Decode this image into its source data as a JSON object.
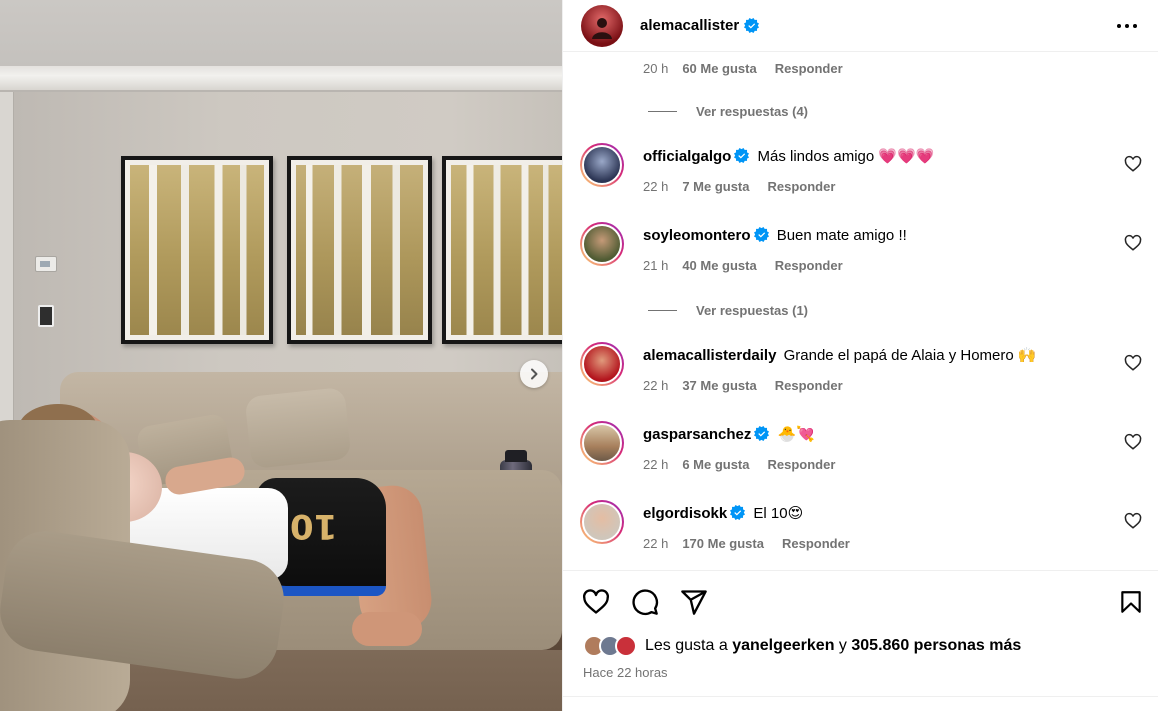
{
  "post": {
    "author": "alemacallister",
    "carousel_next_label": "›"
  },
  "comments_partial": {
    "time": "20 h",
    "likes": "60 Me gusta",
    "reply": "Responder",
    "view_replies": "Ver respuestas (4)"
  },
  "comments": [
    {
      "username": "officialgalgo",
      "verified": true,
      "text": "Más lindos amigo 💗💗💗",
      "time": "22 h",
      "likes": "7 Me gusta",
      "reply": "Responder",
      "avatar_color": "#4b5c8a",
      "ring": "story"
    },
    {
      "username": "soyleomontero",
      "verified": true,
      "text": "Buen mate amigo !!",
      "time": "21 h",
      "likes": "40 Me gusta",
      "reply": "Responder",
      "avatar_color": "#5a6b3c",
      "ring": "story"
    },
    {
      "username": "alemacallisterdaily",
      "verified": false,
      "text": "Grande el papá de Alaia y Homero 🙌",
      "time": "22 h",
      "likes": "37 Me gusta",
      "reply": "Responder",
      "avatar_color": "#c7202a",
      "ring": "story"
    },
    {
      "username": "gasparsanchez",
      "verified": true,
      "text": "🐣💘",
      "time": "22 h",
      "likes": "6 Me gusta",
      "reply": "Responder",
      "avatar_color": "#b8906a",
      "ring": "story"
    },
    {
      "username": "elgordisokk",
      "verified": true,
      "text": "El 10😍",
      "time": "22 h",
      "likes": "170 Me gusta",
      "reply": "Responder",
      "avatar_color": "#d0c6bb",
      "ring": "story"
    }
  ],
  "replies_after_second": "Ver respuestas (1)",
  "actions": {
    "like_icon": "heart-icon",
    "comment_icon": "comment-icon",
    "share_icon": "send-icon",
    "save_icon": "bookmark-icon"
  },
  "likes_summary": {
    "prefix": "Les gusta a",
    "user": "yanelgeerken",
    "connector": "y",
    "others": "305.860 personas más"
  },
  "time_ago": "Hace 22 horas",
  "colors": {
    "verified": "#0095f6",
    "muted": "#737373",
    "heart": "#ed4956",
    "story_ring_start": "#feda75",
    "story_ring_end": "#d62976"
  }
}
